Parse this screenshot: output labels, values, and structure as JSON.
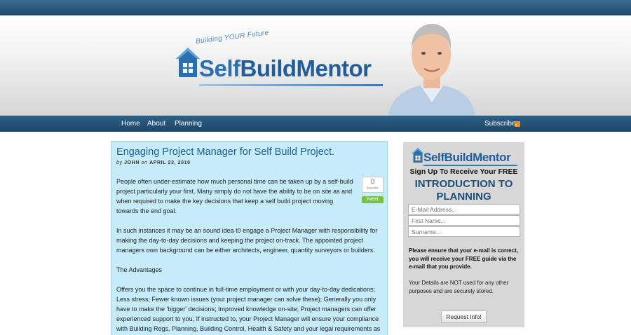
{
  "brand": {
    "tagline": "Building YOUR Future",
    "name_self": "Self",
    "name_build": "Build",
    "name_mentor": "Mentor",
    "colors": {
      "primary": "#215e99",
      "nav": "#1f4a6c",
      "post_bg": "#c6ecfa",
      "tweet": "#76c043"
    }
  },
  "nav": {
    "items": [
      {
        "label": "Home"
      },
      {
        "label": "About"
      },
      {
        "label": "Planning"
      }
    ],
    "subscribe_label": "Subscribe",
    "subscribe_icon": "rss-icon"
  },
  "post": {
    "title": "Engaging Project Manager for Self Build Project.",
    "byline_prefix": "by",
    "author": "JOHN",
    "byline_on": "on",
    "date": "APRIL 23, 2010",
    "tweet_count": "0",
    "tweet_count_label": "tweets",
    "tweet_button": "tweet",
    "paragraphs": [
      "People often under-estimate how much personal time can be taken up by a self-build project particularly your first. Many simply do not have the ability to be on site as and when required to make the key decisions that keep a self build project moving towards the end goal.",
      "In such instances it may be an sound idea t0 engage a Project Manager with responsibility for making the day-to-day decisions and keeping the project on-track.  The appointed project managers own background can be either architects, engineer, quantity surveyors or builders.",
      "The Advantages",
      "Offers you the space to continue in full-time employment or with your day-to-day dedications; Less stress; Fewer known issues (your project manager can solve these); Generally you only have to make the 'bigger' decisions; Improved knowledge on-site; Project managers can offer experienced support to you; If instructed to, your Project Manager will ensure your compliance with Building Regs, Planning, Building Control, Health & Safety and your legal requirements as"
    ]
  },
  "signup": {
    "heading": "Sign Up To Receive Your FREE",
    "title": "INTRODUCTION TO PLANNING",
    "email_placeholder": "E-Mail Address...",
    "first_name_placeholder": "First Name...",
    "surname_placeholder": "Surname...",
    "note": "Please ensure that your e-mail is correct, you will receive your FREE guide via the e-mail that you provide.",
    "privacy": "Your Details are NOT used for any other purposes and are securely stored.",
    "submit_label": "Request Info!"
  }
}
